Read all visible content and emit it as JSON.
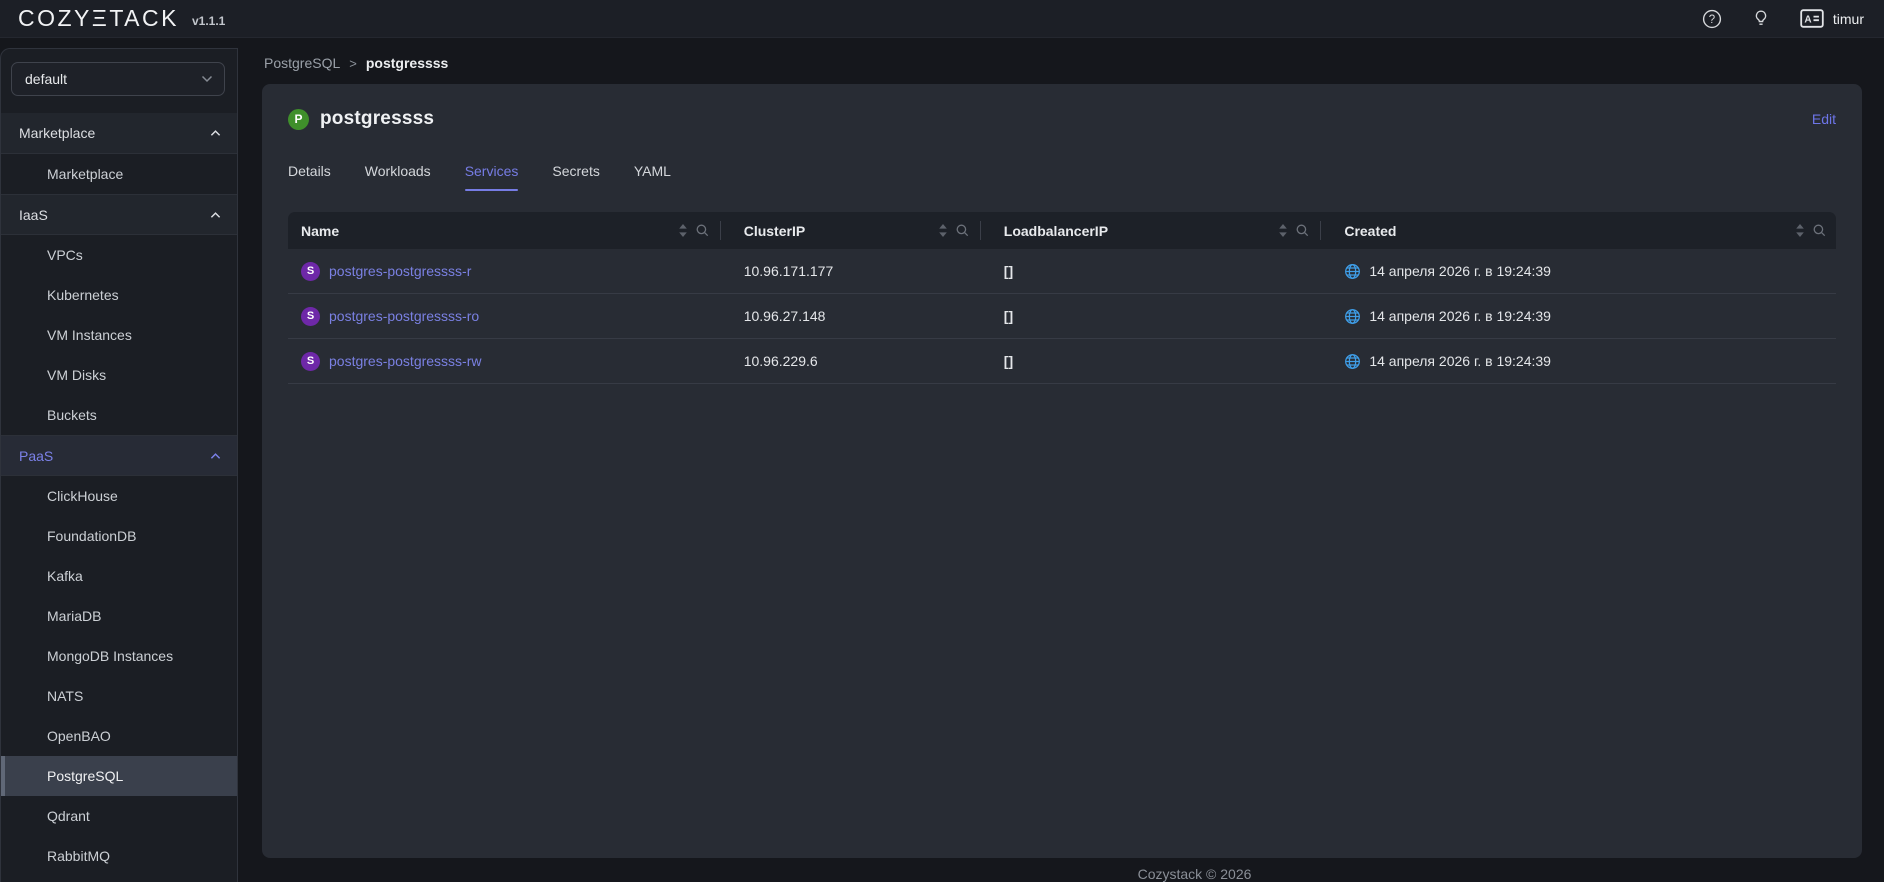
{
  "topbar": {
    "logo": "COZYΞTACK",
    "version": "v1.1.1",
    "user": "timur"
  },
  "sidebar": {
    "tenant_select": {
      "value": "default"
    },
    "sections": [
      {
        "label": "Marketplace",
        "items": [
          {
            "label": "Marketplace"
          }
        ]
      },
      {
        "label": "IaaS",
        "items": [
          {
            "label": "VPCs"
          },
          {
            "label": "Kubernetes"
          },
          {
            "label": "VM Instances"
          },
          {
            "label": "VM Disks"
          },
          {
            "label": "Buckets"
          }
        ]
      },
      {
        "label": "PaaS",
        "items": [
          {
            "label": "ClickHouse"
          },
          {
            "label": "FoundationDB"
          },
          {
            "label": "Kafka"
          },
          {
            "label": "MariaDB"
          },
          {
            "label": "MongoDB Instances"
          },
          {
            "label": "NATS"
          },
          {
            "label": "OpenBAO"
          },
          {
            "label": "PostgreSQL"
          },
          {
            "label": "Qdrant"
          },
          {
            "label": "RabbitMQ"
          }
        ]
      }
    ]
  },
  "breadcrumb": {
    "parent": "PostgreSQL",
    "separator": ">",
    "current": "postgressss"
  },
  "card": {
    "icon_letter": "P",
    "title": "postgressss",
    "edit_label": "Edit",
    "tabs": [
      {
        "label": "Details"
      },
      {
        "label": "Workloads"
      },
      {
        "label": "Services"
      },
      {
        "label": "Secrets"
      },
      {
        "label": "YAML"
      }
    ],
    "active_tab": "Services"
  },
  "table": {
    "columns": [
      {
        "label": "Name"
      },
      {
        "label": "ClusterIP"
      },
      {
        "label": "LoadbalancerIP"
      },
      {
        "label": "Created"
      }
    ],
    "service_icon_letter": "S",
    "rows": [
      {
        "name": "postgres-postgressss-r",
        "cluster_ip": "10.96.171.177",
        "loadbalancer_ip": "[]",
        "created": "14 апреля 2026 г. в 19:24:39"
      },
      {
        "name": "postgres-postgressss-ro",
        "cluster_ip": "10.96.27.148",
        "loadbalancer_ip": "[]",
        "created": "14 апреля 2026 г. в 19:24:39"
      },
      {
        "name": "postgres-postgressss-rw",
        "cluster_ip": "10.96.229.6",
        "loadbalancer_ip": "[]",
        "created": "14 апреля 2026 г. в 19:24:39"
      }
    ]
  },
  "footer": {
    "copyright": "Cozystack © 2026"
  },
  "colors": {
    "accent": "#757ce8",
    "postgres_green": "#3f8f2b",
    "service_purple": "#6e28a8",
    "globe_blue": "#3f9ee8",
    "selected_item_bg": "#3a404c"
  }
}
